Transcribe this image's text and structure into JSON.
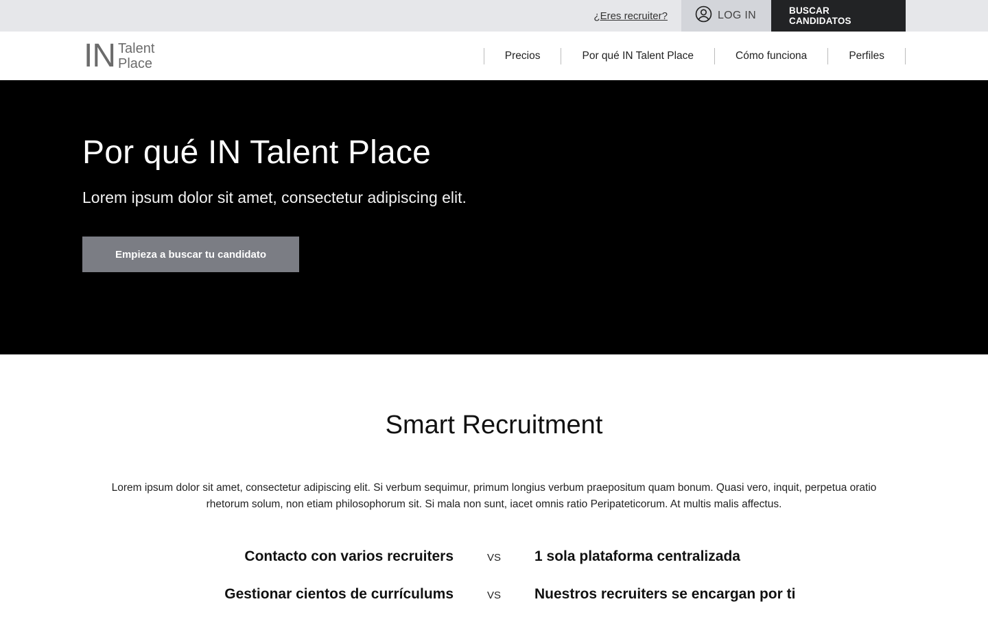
{
  "topbar": {
    "recruiter_link": "¿Eres recruiter?",
    "login_label": "LOG IN",
    "search_button": "BUSCAR CANDIDATOS"
  },
  "logo": {
    "mark": "IN",
    "line1": "Talent",
    "line2": "Place"
  },
  "nav": {
    "items": [
      {
        "label": "Precios"
      },
      {
        "label": "Por qué IN Talent Place"
      },
      {
        "label": "Cómo funciona"
      },
      {
        "label": "Perfiles"
      }
    ]
  },
  "hero": {
    "title": "Por qué IN Talent Place",
    "subtitle": "Lorem ipsum dolor sit amet, consectetur adipiscing elit.",
    "cta": "Empieza a buscar tu candidato"
  },
  "section": {
    "title": "Smart Recruitment",
    "body": "Lorem ipsum dolor sit amet, consectetur adipiscing elit. Si verbum sequimur, primum longius verbum praepositum quam bonum. Quasi vero, inquit, perpetua oratio rhetorum solum, non etiam philosophorum sit. Si mala non sunt, iacet omnis ratio Peripateticorum. At multis malis affectus.",
    "comparisons": [
      {
        "left": "Contacto con varios recruiters",
        "vs": "VS",
        "right": "1 sola plataforma centralizada"
      },
      {
        "left": "Gestionar cientos de currículums",
        "vs": "VS",
        "right": "Nuestros recruiters se encargan por ti"
      }
    ]
  },
  "colors": {
    "topbar_bg": "#e6e7ea",
    "login_bg": "#d3d5da",
    "search_button_bg": "#222325",
    "hero_bg": "#000000",
    "cta_bg": "#7b7d84"
  },
  "icons": {
    "login": "user-circle-icon"
  }
}
